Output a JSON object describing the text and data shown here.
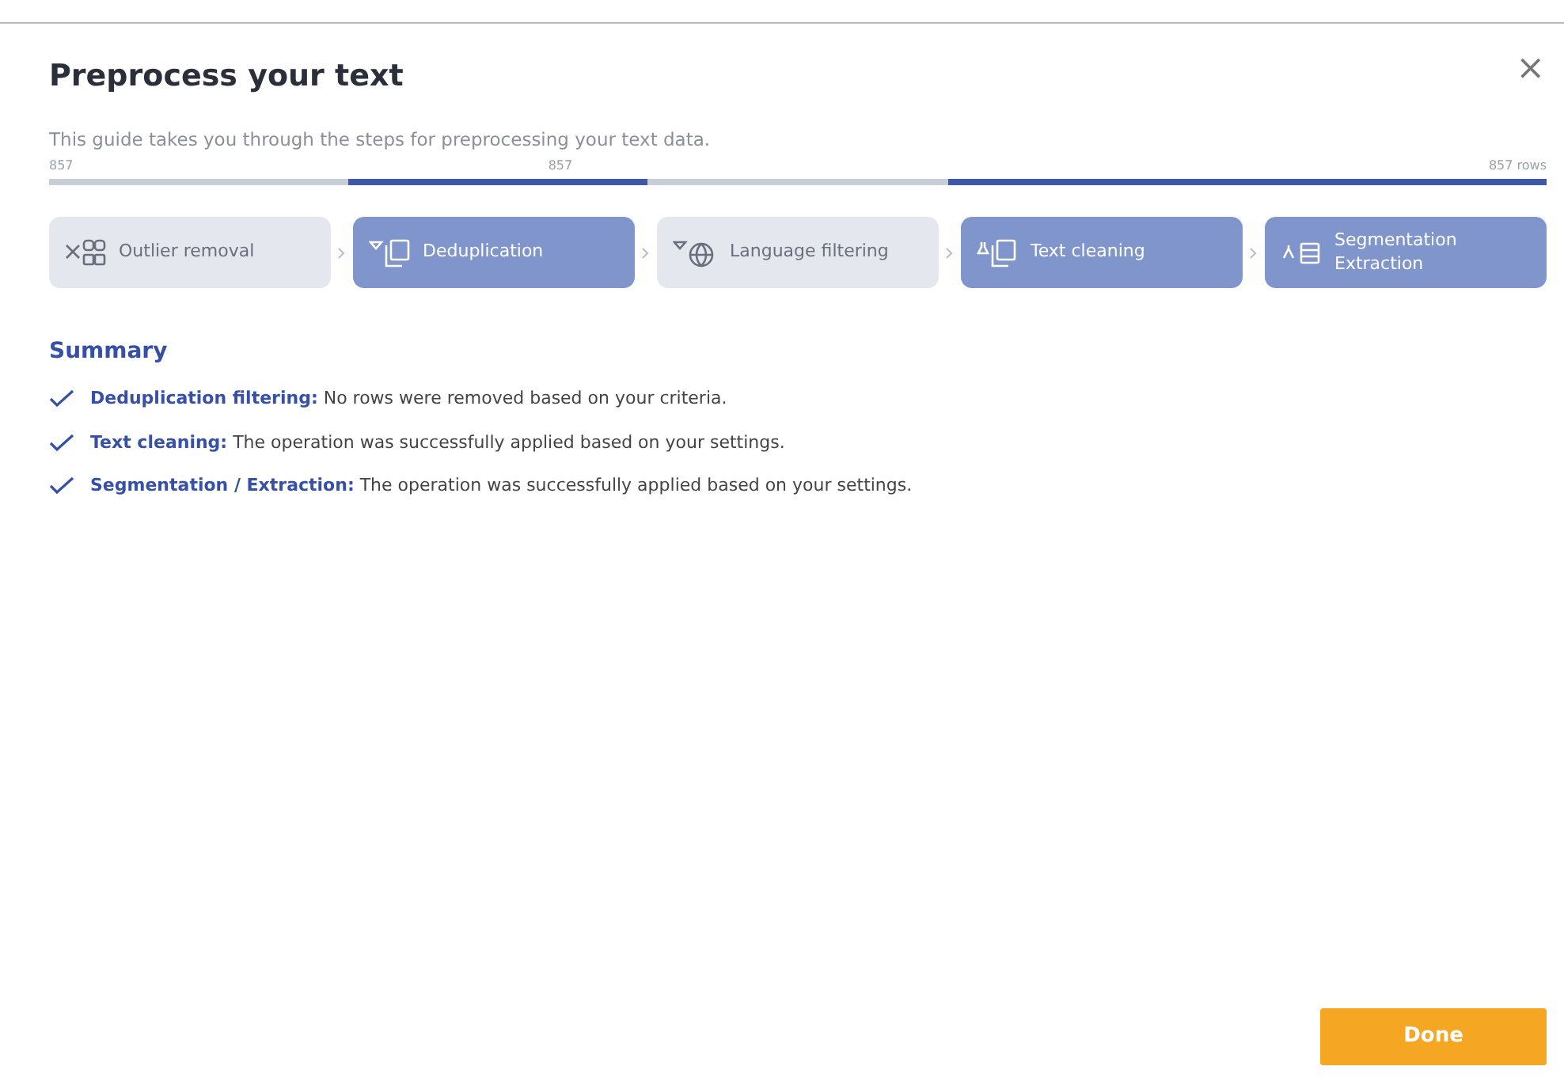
{
  "dialog": {
    "title": "Preprocess your text",
    "close": "×",
    "description": "This guide takes you through the steps for preprocessing your text data."
  },
  "row_counts": [
    {
      "text": "857"
    },
    {
      "text": "857"
    },
    {
      "text": "857 rows"
    }
  ],
  "steps": [
    {
      "label": "Outlier removal",
      "selected": false,
      "kind": "outlier"
    },
    {
      "label": "Deduplication",
      "selected": true,
      "kind": "dedup"
    },
    {
      "label": "Language filtering",
      "selected": false,
      "kind": "language"
    },
    {
      "label": "Text cleaning",
      "selected": true,
      "kind": "cleaning"
    },
    {
      "label": "Segmentation\nExtraction",
      "selected": true,
      "kind": "segmentation"
    }
  ],
  "summary": {
    "title": "Summary",
    "items": [
      {
        "text": "**Deduplication filtering:** No rows were removed based on your criteria."
      },
      {
        "text": "**Text cleaning:** The operation was successfully applied based on your settings."
      },
      {
        "text": "**Segmentation / Extraction:** The operation was successfully applied based on your settings."
      }
    ]
  },
  "buttons": [
    {
      "label": "Done"
    }
  ]
}
